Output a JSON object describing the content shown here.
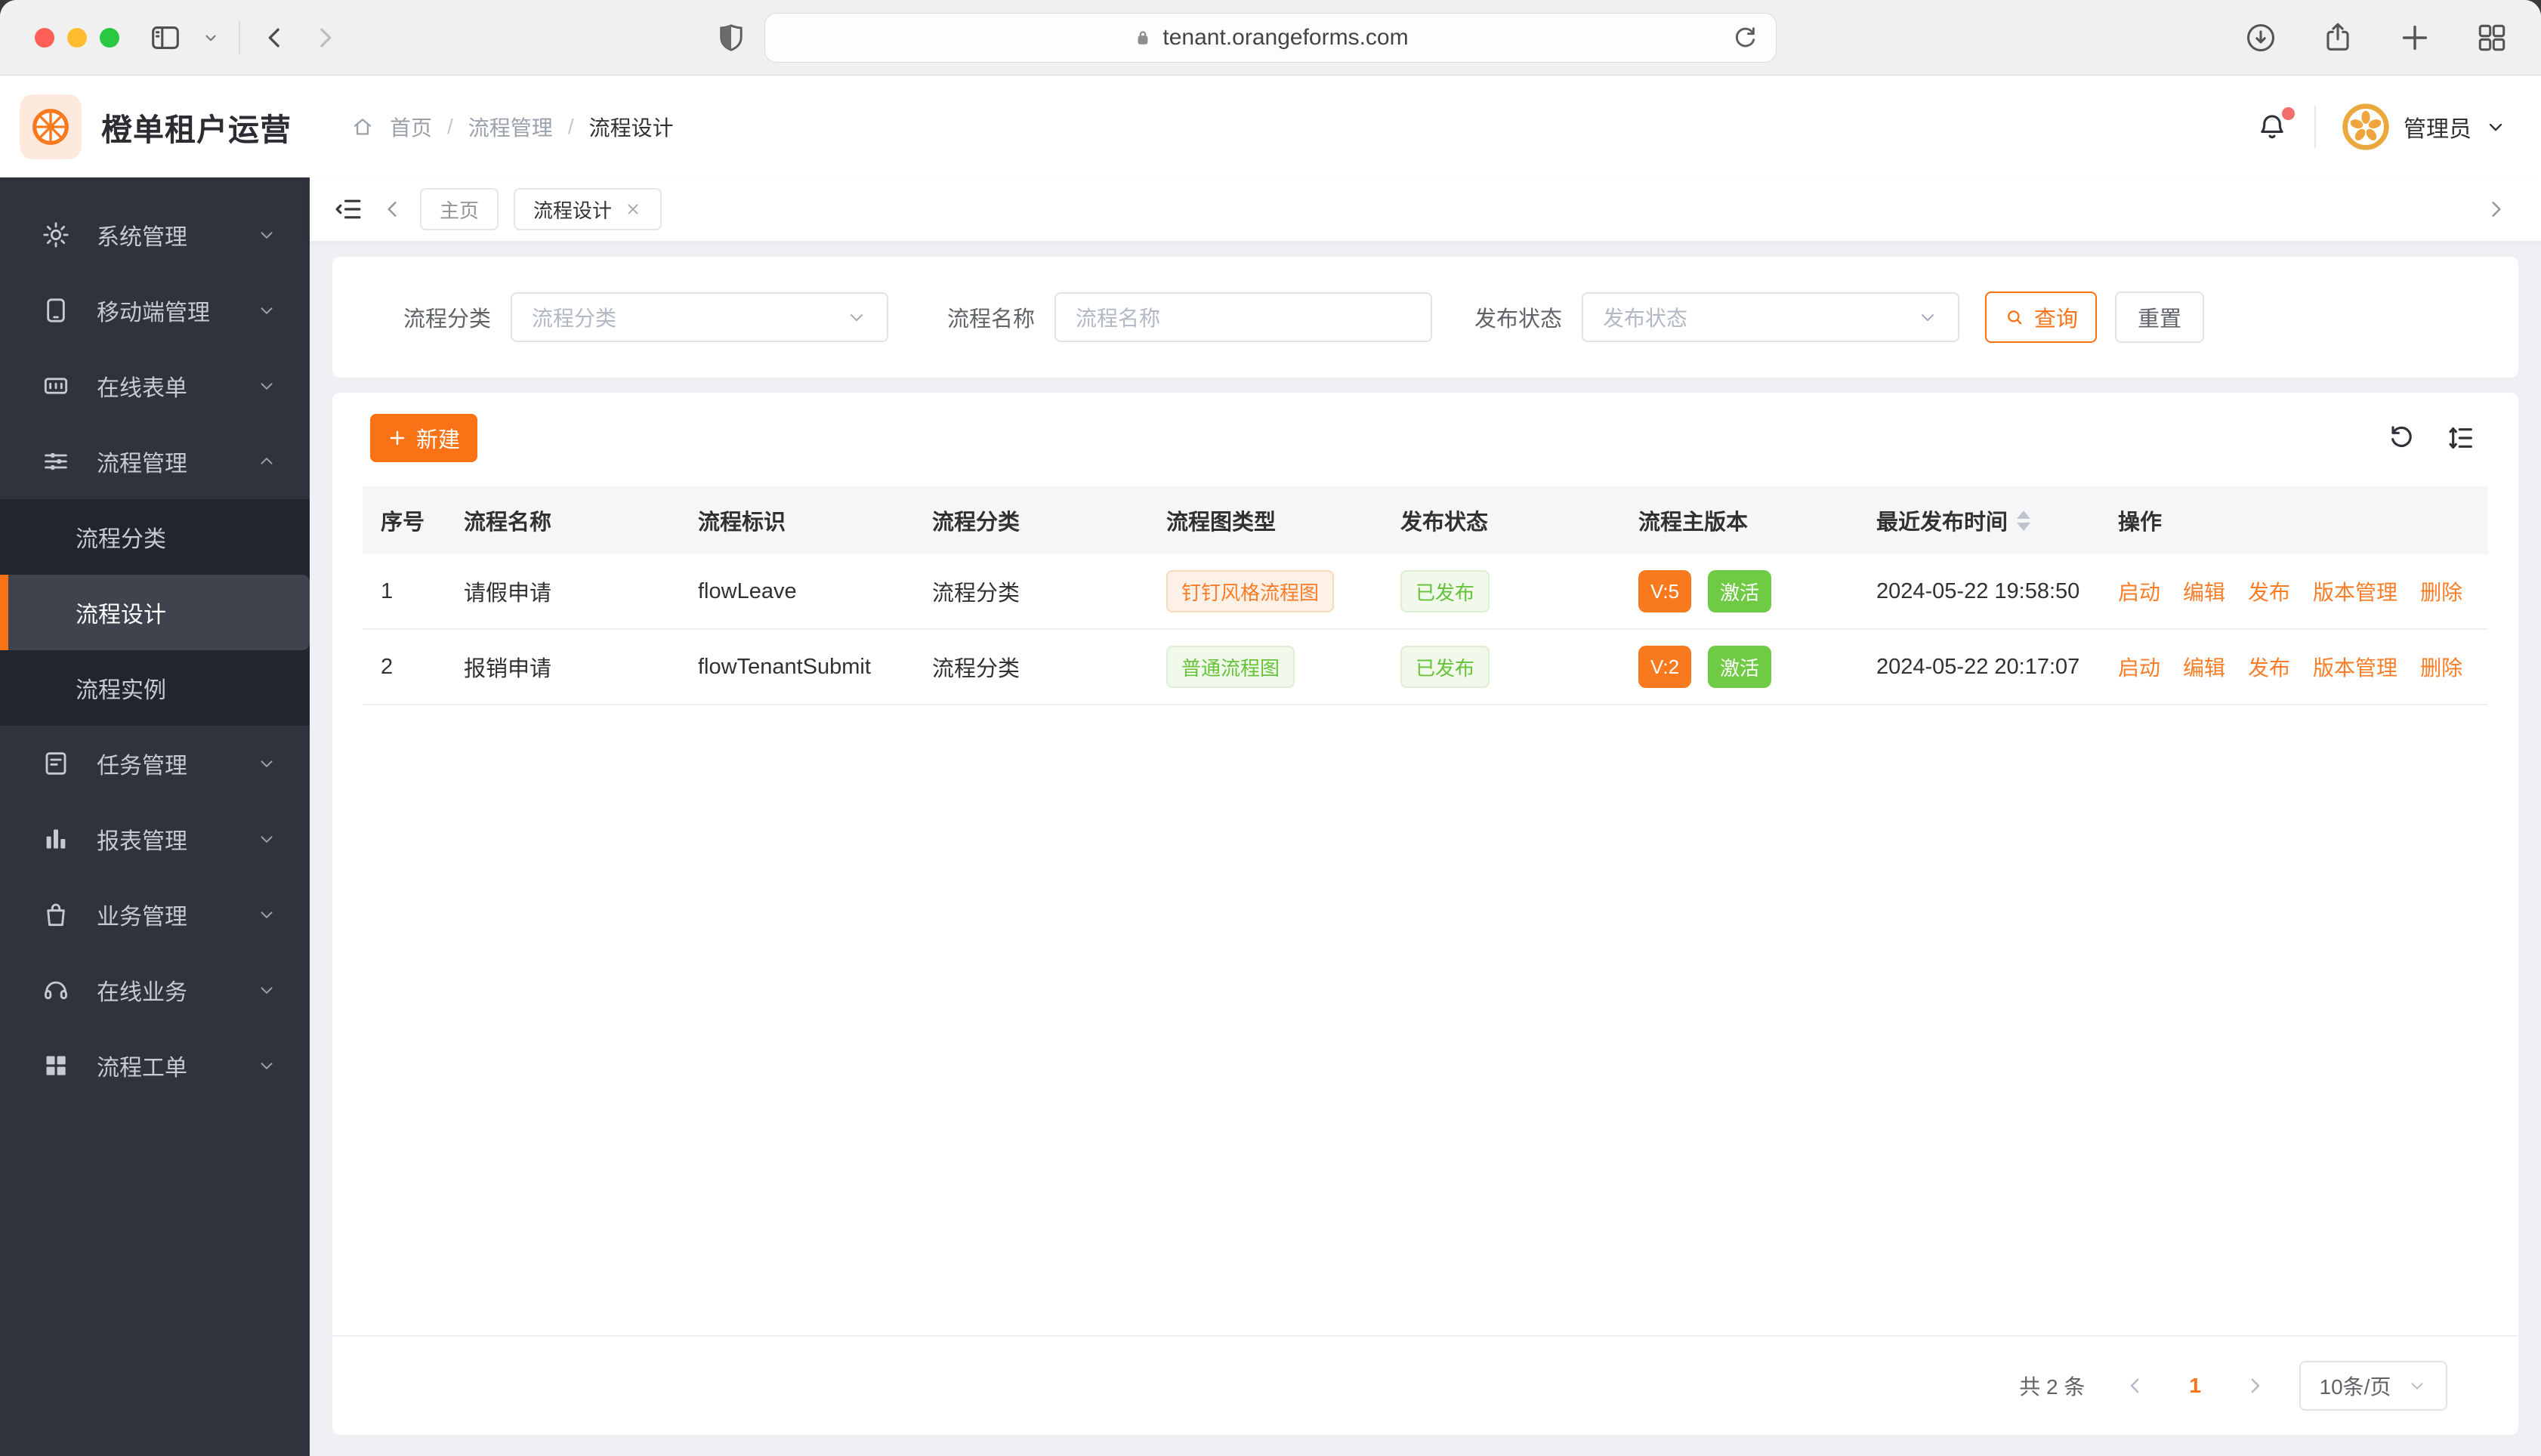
{
  "browser": {
    "url_label": "tenant.orangeforms.com"
  },
  "header": {
    "app_title": "橙单租户运营",
    "breadcrumb": [
      "首页",
      "流程管理",
      "流程设计"
    ],
    "user_label": "管理员"
  },
  "sidebar": {
    "items": [
      {
        "label": "系统管理"
      },
      {
        "label": "移动端管理"
      },
      {
        "label": "在线表单"
      },
      {
        "label": "流程管理"
      },
      {
        "label": "任务管理"
      },
      {
        "label": "报表管理"
      },
      {
        "label": "业务管理"
      },
      {
        "label": "在线业务"
      },
      {
        "label": "流程工单"
      }
    ],
    "submenu_items": [
      {
        "label": "流程分类"
      },
      {
        "label": "流程设计",
        "active": true
      },
      {
        "label": "流程实例"
      }
    ]
  },
  "tabs": {
    "items": [
      {
        "label": "主页"
      },
      {
        "label": "流程设计",
        "closable": true
      }
    ]
  },
  "filters": {
    "category_label": "流程分类",
    "category_placeholder": "流程分类",
    "name_label": "流程名称",
    "name_placeholder": "流程名称",
    "status_label": "发布状态",
    "status_placeholder": "发布状态",
    "query_label": "查询",
    "reset_label": "重置"
  },
  "toolbar": {
    "create_label": "新建"
  },
  "table": {
    "columns": [
      "序号",
      "流程名称",
      "流程标识",
      "流程分类",
      "流程图类型",
      "发布状态",
      "流程主版本",
      "最近发布时间",
      "操作"
    ],
    "rows": [
      {
        "index": "1",
        "name": "请假申请",
        "key": "flowLeave",
        "category": "流程分类",
        "diagram_type": "钉钉风格流程图",
        "diagram_style": "orange",
        "publish_status": "已发布",
        "version": "V:5",
        "active": "激活",
        "published_at": "2024-05-22 19:58:50"
      },
      {
        "index": "2",
        "name": "报销申请",
        "key": "flowTenantSubmit",
        "category": "流程分类",
        "diagram_type": "普通流程图",
        "diagram_style": "green",
        "publish_status": "已发布",
        "version": "V:2",
        "active": "激活",
        "published_at": "2024-05-22 20:17:07"
      }
    ],
    "actions": [
      "启动",
      "编辑",
      "发布",
      "版本管理",
      "删除"
    ]
  },
  "pagination": {
    "total_label": "共 2 条",
    "current_page": "1",
    "page_size_label": "10条/页"
  },
  "colors": {
    "primary_orange": "#f97316",
    "success_green": "#6fcb43",
    "tag_orange_text": "#f97c26",
    "tag_green_text": "#67c23a",
    "sidebar_bg": "#2e333d",
    "submenu_bg": "#22252d",
    "active_item_bg": "#3e434e"
  }
}
